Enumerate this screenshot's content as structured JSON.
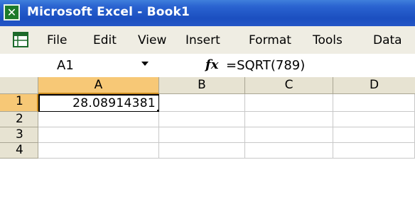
{
  "window": {
    "title": "Microsoft Excel - Book1",
    "app_icon": "excel-icon"
  },
  "menu": {
    "doc_icon": "workbook-icon",
    "items": [
      {
        "label": "File"
      },
      {
        "label": "Edit"
      },
      {
        "label": "View"
      },
      {
        "label": "Insert"
      },
      {
        "label": "Format"
      },
      {
        "label": "Tools"
      },
      {
        "label": "Data"
      }
    ]
  },
  "formula_bar": {
    "name_box": "A1",
    "fx_symbol": "fx",
    "formula": "=SQRT(789)"
  },
  "sheet": {
    "columns": [
      "A",
      "B",
      "C",
      "D"
    ],
    "rows": [
      "1",
      "2",
      "3",
      "4"
    ],
    "active_cell": "A1",
    "cells": {
      "A1": "28.08914381"
    }
  },
  "colors": {
    "title_bar": "#2a63d0",
    "header_active": "#f7c876",
    "chrome": "#efede3"
  }
}
